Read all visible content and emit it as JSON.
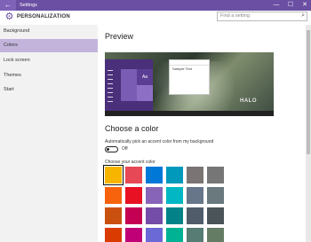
{
  "window": {
    "title": "Settings",
    "back_glyph": "←",
    "min_glyph": "—",
    "max_glyph": "☐",
    "close_glyph": "✕"
  },
  "header": {
    "title": "PERSONALIZATION",
    "icon": "gear-icon",
    "search_placeholder": "Find a setting",
    "search_icon": "search-icon"
  },
  "sidebar": {
    "items": [
      {
        "label": "Background"
      },
      {
        "label": "Colors",
        "active": true
      },
      {
        "label": "Lock screen"
      },
      {
        "label": "Themes"
      },
      {
        "label": "Start"
      }
    ]
  },
  "main": {
    "preview_heading": "Preview",
    "preview_sample_text": "Sample Text",
    "preview_tile_text": "Aa",
    "preview_logo_text": "HALO",
    "color_heading": "Choose a color",
    "auto_pick_label": "Automatically pick an accent color from my background",
    "toggle_state": "Off",
    "accent_label": "Choose your accent color"
  },
  "colors": {
    "accent": "#6b4fa3",
    "swatches": [
      [
        "#f7b500",
        "#e74856",
        "#0078d7",
        "#0099bc",
        "#7a7574",
        "#767676"
      ],
      [
        "#f7630c",
        "#e81123",
        "#8764b8",
        "#00b7c3",
        "#68768a",
        "#69797e"
      ],
      [
        "#ca5010",
        "#c30052",
        "#744da9",
        "#038387",
        "#515c6b",
        "#4a5459"
      ],
      [
        "#da3b01",
        "#bf0077",
        "#6b69d6",
        "#00b294",
        "#567c73",
        "#647c64"
      ]
    ]
  }
}
